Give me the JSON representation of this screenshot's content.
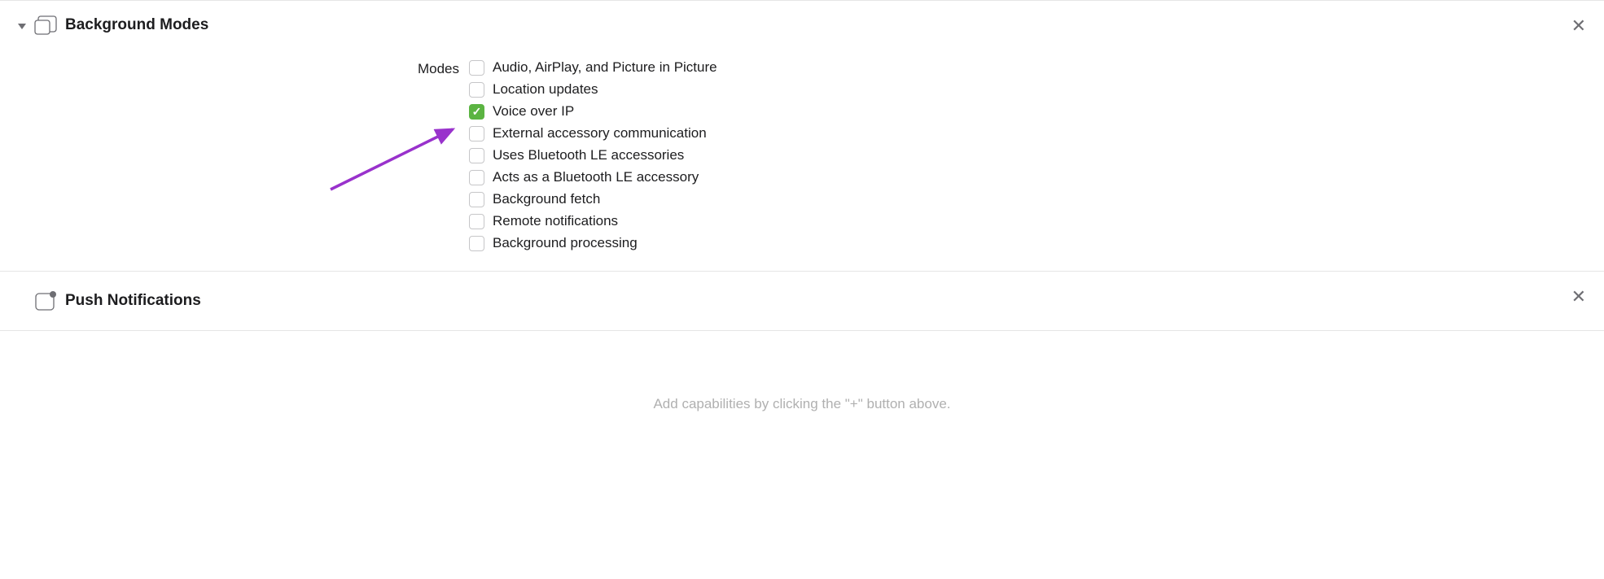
{
  "backgroundModes": {
    "title": "Background Modes",
    "modesLabel": "Modes",
    "items": [
      {
        "label": "Audio, AirPlay, and Picture in Picture",
        "checked": false
      },
      {
        "label": "Location updates",
        "checked": false
      },
      {
        "label": "Voice over IP",
        "checked": true
      },
      {
        "label": "External accessory communication",
        "checked": false
      },
      {
        "label": "Uses Bluetooth LE accessories",
        "checked": false
      },
      {
        "label": "Acts as a Bluetooth LE accessory",
        "checked": false
      },
      {
        "label": "Background fetch",
        "checked": false
      },
      {
        "label": "Remote notifications",
        "checked": false
      },
      {
        "label": "Background processing",
        "checked": false
      }
    ]
  },
  "pushNotifications": {
    "title": "Push Notifications"
  },
  "footerHint": "Add capabilities by clicking the \"+\" button above."
}
